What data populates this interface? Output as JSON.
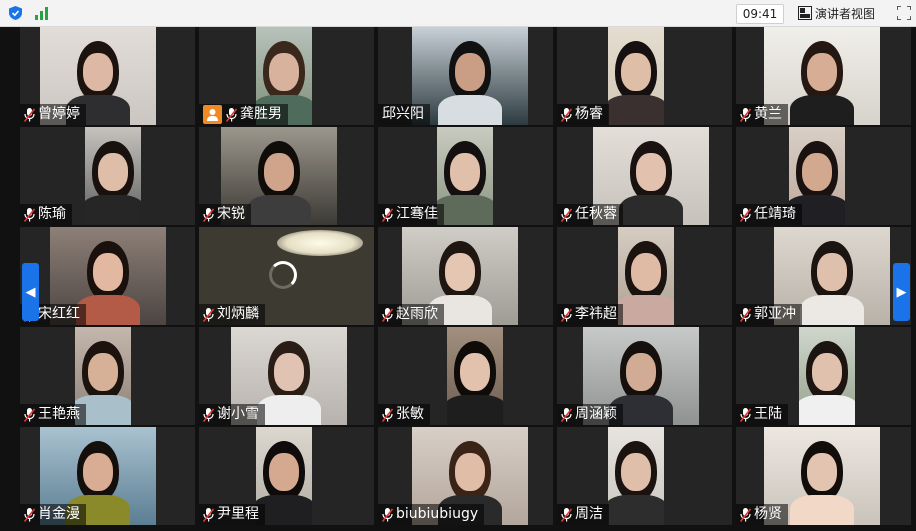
{
  "topbar": {
    "time": "09:41",
    "speaker_view_label": "演讲者视图",
    "icons": [
      "shield-icon",
      "signal-icon",
      "speaker-view-icon",
      "fullscreen-icon"
    ]
  },
  "navigation": {
    "prev_label": "◀",
    "next_label": "▶"
  },
  "participants": [
    {
      "name": "曾婷婷",
      "mic": true,
      "bg": "#cbc6c1",
      "wall": "#e2ddd8",
      "shirt": "#2e2e31",
      "skin": "#ddb8a4",
      "hair": "#1c130f"
    },
    {
      "name": "龚胜男",
      "mic": true,
      "person_icon": true,
      "bg": "#7f8f78",
      "wall": "#b7c2bb",
      "shirt": "#4f6b5c",
      "skin": "#d9b29d",
      "hair": "#3b281d"
    },
    {
      "name": "邱兴阳",
      "mic": false,
      "bg": "#2d3b40",
      "wall": "#c7d0d6",
      "shirt": "#d7dde0",
      "skin": "#c99e85",
      "hair": "#111111"
    },
    {
      "name": "杨睿",
      "mic": true,
      "bg": "#cfc6b4",
      "wall": "#e5ddd0",
      "shirt": "#3a3030",
      "skin": "#dfbea8",
      "hair": "#161010"
    },
    {
      "name": "黄兰",
      "mic": true,
      "bg": "#d6d2cc",
      "wall": "#f1efe9",
      "shirt": "#1e1e1e",
      "skin": "#d7ad95",
      "hair": "#251812"
    },
    {
      "name": "陈瑜",
      "mic": true,
      "bg": "#5d5f61",
      "wall": "#c6c3be",
      "shirt": "#262626",
      "skin": "#dfbea9",
      "hair": "#18110d"
    },
    {
      "name": "宋锐",
      "mic": true,
      "bg": "#3c3a35",
      "wall": "#9c978d",
      "shirt": "#3d3d3d",
      "skin": "#cfa48b",
      "hair": "#0f0c0a"
    },
    {
      "name": "江骞佳",
      "mic": true,
      "bg": "#8a9480",
      "wall": "#c9cbc0",
      "shirt": "#5e6a5a",
      "skin": "#e0c0aa",
      "hair": "#141010"
    },
    {
      "name": "任秋蓉",
      "mic": true,
      "bg": "#c7c1bb",
      "wall": "#e3ded8",
      "shirt": "#2b2b2b",
      "skin": "#e2c1ae",
      "hair": "#1a1210"
    },
    {
      "name": "任靖琦",
      "mic": true,
      "bg": "#bca79a",
      "wall": "#d9cfc6",
      "shirt": "#1f1f24",
      "skin": "#d2a88f",
      "hair": "#1a1210"
    },
    {
      "name": "宋红红",
      "mic": true,
      "bg": "#4d4542",
      "wall": "#8d8078",
      "shirt": "#b45b47",
      "skin": "#e2b8a0",
      "hair": "#1a100c"
    },
    {
      "name": "刘炳麟",
      "mic": true,
      "spinner": true,
      "bg": "#3d3a31",
      "wall": "#5a5547",
      "shirt": "#2a2824",
      "skin": "#6d5a45",
      "hair": "#1a1611"
    },
    {
      "name": "赵雨欣",
      "mic": true,
      "bg": "#9f9b95",
      "wall": "#d0cdc7",
      "shirt": "#e9e5e0",
      "skin": "#e4c6b2",
      "hair": "#1f1612"
    },
    {
      "name": "李祎超",
      "mic": true,
      "bg": "#aca093",
      "wall": "#d6cdc2",
      "shirt": "#caa9a0",
      "skin": "#dfbba6",
      "hair": "#1b1310"
    },
    {
      "name": "郭亚冲",
      "mic": true,
      "bg": "#b9b2a9",
      "wall": "#ddd7cf",
      "shirt": "#ece8e4",
      "skin": "#dfc0ad",
      "hair": "#1c1410"
    },
    {
      "name": "王艳燕",
      "mic": true,
      "bg": "#8c7f76",
      "wall": "#c4b8ae",
      "shirt": "#a9bfc9",
      "skin": "#d7b098",
      "hair": "#1c130e"
    },
    {
      "name": "谢小雪",
      "mic": true,
      "bg": "#b7b2ad",
      "wall": "#dbd7d2",
      "shirt": "#eeeeee",
      "skin": "#e0c3b2",
      "hair": "#2a1d16"
    },
    {
      "name": "张敏",
      "mic": true,
      "bg": "#6c5d51",
      "wall": "#a28f7f",
      "shirt": "#1e1e1e",
      "skin": "#e2c1ad",
      "hair": "#0f0b09"
    },
    {
      "name": "周涵颖",
      "mic": true,
      "bg": "#8f9291",
      "wall": "#c8cac9",
      "shirt": "#2d2f35",
      "skin": "#d2ab95",
      "hair": "#15100e"
    },
    {
      "name": "王陆",
      "mic": true,
      "bg": "#94a08b",
      "wall": "#d0d6cc",
      "shirt": "#f0f0f0",
      "skin": "#e0c1ad",
      "hair": "#1c1410"
    },
    {
      "name": "肖金漫",
      "mic": true,
      "bg": "#5c7e93",
      "wall": "#a9c2d0",
      "shirt": "#8a8a2a",
      "skin": "#d8ad94",
      "hair": "#150f0c"
    },
    {
      "name": "尹里程",
      "mic": true,
      "bg": "#b1aca2",
      "wall": "#dcd8d0",
      "shirt": "#1f1f22",
      "skin": "#d4a98f",
      "hair": "#0e0b0a"
    },
    {
      "name": "biubiubiugy",
      "mic": true,
      "bg": "#b3a69c",
      "wall": "#d8cfc6",
      "shirt": "#2a2a2a",
      "skin": "#e0bda7",
      "hair": "#3a2418"
    },
    {
      "name": "周洁",
      "mic": true,
      "bg": "#c9c5bf",
      "wall": "#e7e3de",
      "shirt": "#2d2d2d",
      "skin": "#dfbfaa",
      "hair": "#1b1310"
    },
    {
      "name": "杨贤",
      "mic": true,
      "bg": "#c9c3bb",
      "wall": "#ece7e0",
      "shirt": "#f2d8c7",
      "skin": "#e3c4b0",
      "hair": "#120d0b"
    }
  ]
}
